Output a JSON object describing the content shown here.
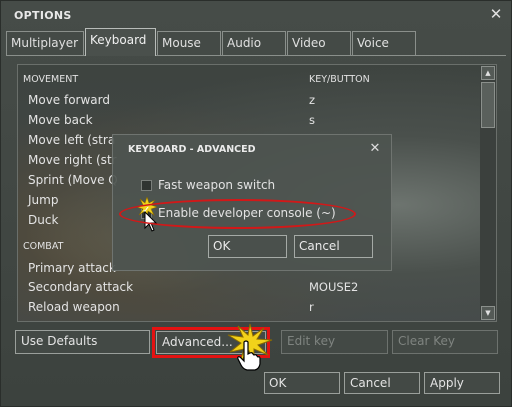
{
  "window": {
    "title": "OPTIONS"
  },
  "tabs": [
    "Multiplayer",
    "Keyboard",
    "Mouse",
    "Audio",
    "Video",
    "Voice"
  ],
  "active_tab": "Keyboard",
  "bindings": {
    "col_action": "MOVEMENT",
    "col_key": "KEY/BUTTON",
    "movement": [
      {
        "action": "Move forward",
        "key": "z"
      },
      {
        "action": "Move back",
        "key": "s"
      },
      {
        "action": "Move left (stra",
        "key": ""
      },
      {
        "action": "Move right (str",
        "key": ""
      },
      {
        "action": "Sprint (Move Q",
        "key": ""
      },
      {
        "action": "Jump",
        "key": ""
      },
      {
        "action": "Duck",
        "key": ""
      }
    ],
    "combat_header": "COMBAT",
    "combat": [
      {
        "action": "Primary attack",
        "key": ""
      },
      {
        "action": "Secondary attack",
        "key": "MOUSE2"
      },
      {
        "action": "Reload weapon",
        "key": "r"
      }
    ]
  },
  "buttons": {
    "use_defaults": "Use Defaults",
    "advanced": "Advanced...",
    "edit_key": "Edit key",
    "clear_key": "Clear Key",
    "ok": "OK",
    "cancel": "Cancel",
    "apply": "Apply"
  },
  "dialog": {
    "title": "KEYBOARD - ADVANCED",
    "options": [
      {
        "label": "Fast weapon switch",
        "checked": false
      },
      {
        "label": "Enable developer console (~)",
        "checked": true
      }
    ],
    "ok": "OK",
    "cancel": "Cancel"
  },
  "colors": {
    "highlight_red": "#e31212",
    "starburst": "#f2d21a"
  }
}
